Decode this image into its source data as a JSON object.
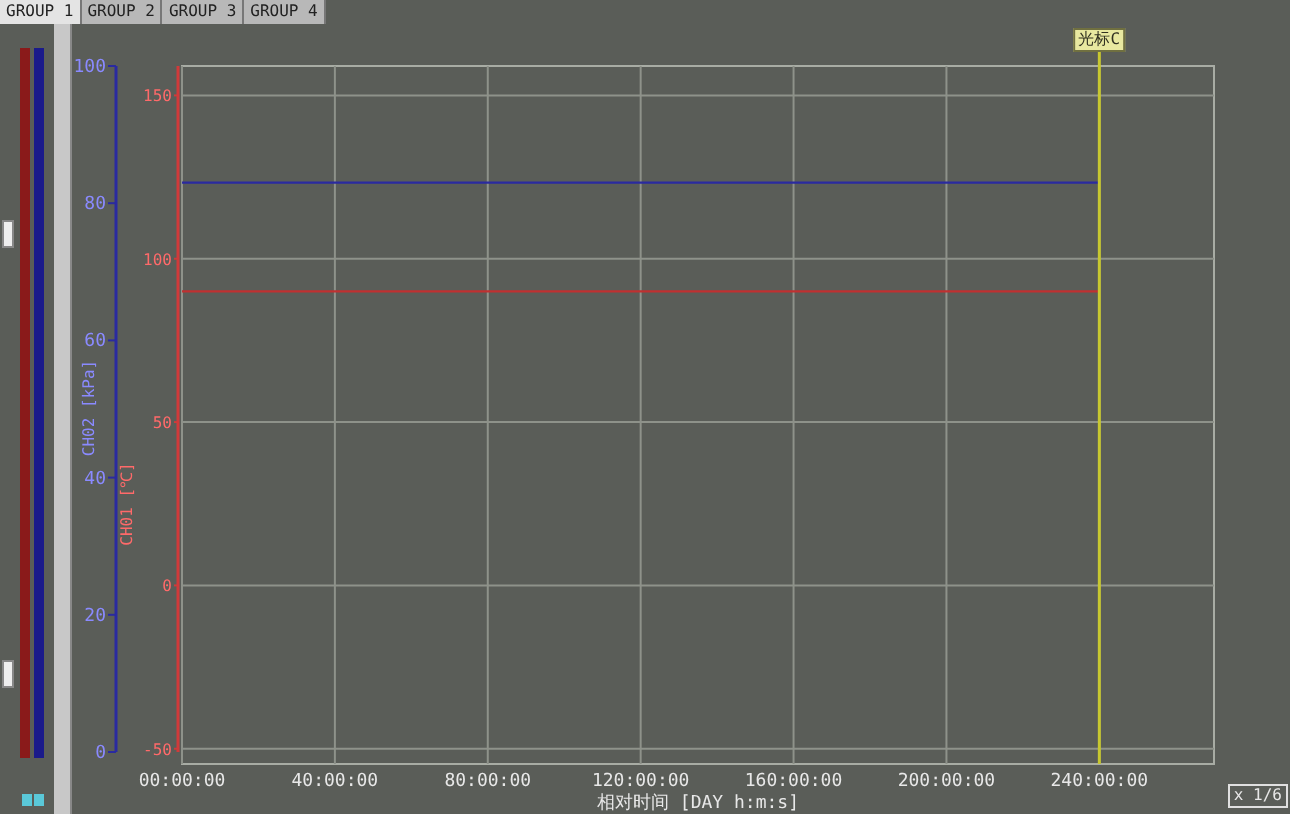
{
  "tabs": [
    {
      "label": "GROUP 1",
      "selected": true
    },
    {
      "label": "GROUP 2",
      "selected": false
    },
    {
      "label": "GROUP 3",
      "selected": false
    },
    {
      "label": "GROUP 4",
      "selected": false
    }
  ],
  "meters": [
    {
      "color": "#8a1a1a",
      "level": 1
    },
    {
      "color": "#1a1a8a",
      "level": 1
    }
  ],
  "chart": {
    "page": "x 1/6",
    "chart_data": {
      "type": "line",
      "xlabel": "相对时间 [DAY h:m:s]",
      "ylabel": "CH02 [kPa]",
      "y2label": "CH01 [℃]",
      "grid": true,
      "x": [
        0,
        240
      ],
      "series": [
        {
          "color": "#2a2aa0",
          "values": [
            83,
            83
          ],
          "axis": "y"
        },
        {
          "color": "#c03030",
          "values": [
            90,
            90
          ],
          "axis": "y2"
        }
      ],
      "xlim": [
        0,
        270
      ],
      "ylim": [
        0,
        100
      ],
      "y2lim": [
        -51,
        159
      ],
      "xticks": [
        {
          "value": 0,
          "label": "00:00:00"
        },
        {
          "value": 40,
          "label": "40:00:00"
        },
        {
          "value": 80,
          "label": "80:00:00"
        },
        {
          "value": 120,
          "label": "120:00:00"
        },
        {
          "value": 160,
          "label": "160:00:00"
        },
        {
          "value": 200,
          "label": "200:00:00"
        },
        {
          "value": 240,
          "label": "240:00:00"
        }
      ],
      "yticks": [
        0,
        20,
        40,
        60,
        80,
        100
      ],
      "y2ticks": [
        -50,
        0,
        50,
        100,
        150
      ],
      "ref_lines": [
        {
          "axis": "x",
          "value": 240,
          "label": "光标C"
        }
      ]
    }
  }
}
